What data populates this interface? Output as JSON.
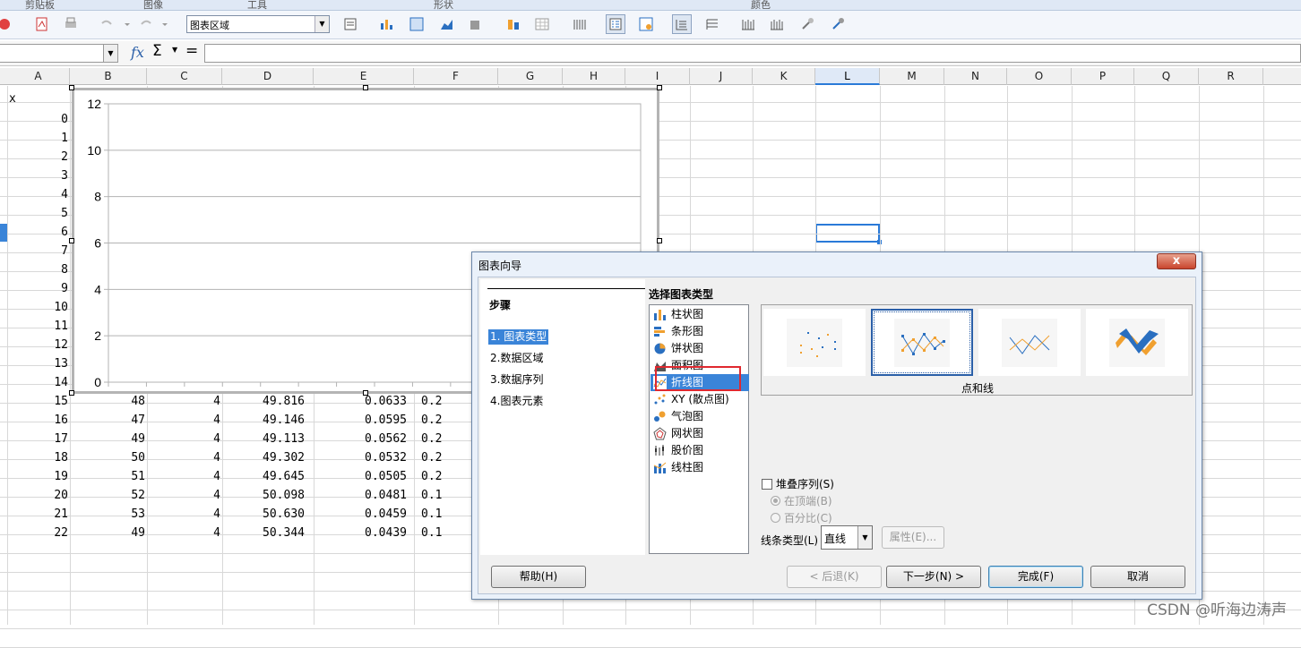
{
  "ribbon_groups": [
    "剪贴板",
    "图像",
    "工具",
    "形状",
    "颜色"
  ],
  "toolbar": {
    "chart_area_select": "图表区域"
  },
  "formula_bar": {
    "fx_label": "fx",
    "sum_label": "Σ",
    "equals_label": "="
  },
  "columns": [
    "A",
    "B",
    "C",
    "D",
    "E",
    "F",
    "G",
    "H",
    "I",
    "J",
    "K",
    "L",
    "M",
    "N",
    "O",
    "P",
    "Q",
    "R"
  ],
  "selected_column": "L",
  "cells": {
    "a1": "x",
    "col_a_values": [
      "0",
      "1",
      "2",
      "3",
      "4",
      "5",
      "6",
      "7",
      "8",
      "9",
      "10",
      "11",
      "12",
      "13",
      "14",
      "15",
      "16",
      "17",
      "18",
      "19",
      "20",
      "21",
      "22"
    ],
    "rows": [
      {
        "b": "48",
        "c": "4",
        "d": "49.816",
        "e": "0.0633",
        "f": "0.2"
      },
      {
        "b": "47",
        "c": "4",
        "d": "49.146",
        "e": "0.0595",
        "f": "0.2"
      },
      {
        "b": "49",
        "c": "4",
        "d": "49.113",
        "e": "0.0562",
        "f": "0.2"
      },
      {
        "b": "50",
        "c": "4",
        "d": "49.302",
        "e": "0.0532",
        "f": "0.2"
      },
      {
        "b": "51",
        "c": "4",
        "d": "49.645",
        "e": "0.0505",
        "f": "0.2"
      },
      {
        "b": "52",
        "c": "4",
        "d": "50.098",
        "e": "0.0481",
        "f": "0.1"
      },
      {
        "b": "53",
        "c": "4",
        "d": "50.630",
        "e": "0.0459",
        "f": "0.1"
      },
      {
        "b": "49",
        "c": "4",
        "d": "50.344",
        "e": "0.0439",
        "f": "0.1"
      }
    ]
  },
  "chart_data": {
    "type": "line",
    "ylim": [
      0,
      12
    ],
    "yticks": [
      "0",
      "2",
      "4",
      "6",
      "8",
      "10",
      "12"
    ],
    "grid": true,
    "series": []
  },
  "dialog": {
    "title": "图表向导",
    "close": "x",
    "steps_header": "步骤",
    "steps": [
      "1. 图表类型",
      "2.数据区域",
      "3.数据序列",
      "4.图表元素"
    ],
    "chart_types_title": "选择图表类型",
    "chart_types": [
      "柱状图",
      "条形图",
      "饼状图",
      "面积图",
      "折线图",
      "XY (散点图)",
      "气泡图",
      "网状图",
      "股价图",
      "线柱图"
    ],
    "selected_type": "折线图",
    "variant_label": "点和线",
    "stack_series": "堆叠序列(S)",
    "on_top": "在顶端(B)",
    "percent": "百分比(C)",
    "line_type_label": "线条类型(L)",
    "line_type_value": "直线",
    "properties": "属性(E)...",
    "help": "帮助(H)",
    "back": "< 后退(K)",
    "next": "下一步(N) >",
    "finish": "完成(F)",
    "cancel": "取消"
  },
  "watermark": "CSDN @听海边涛声",
  "colors": {
    "accent": "#3a84d8",
    "highlight": "#e0282f",
    "series_orange": "#f0a030",
    "series_blue": "#2a6fc0"
  }
}
